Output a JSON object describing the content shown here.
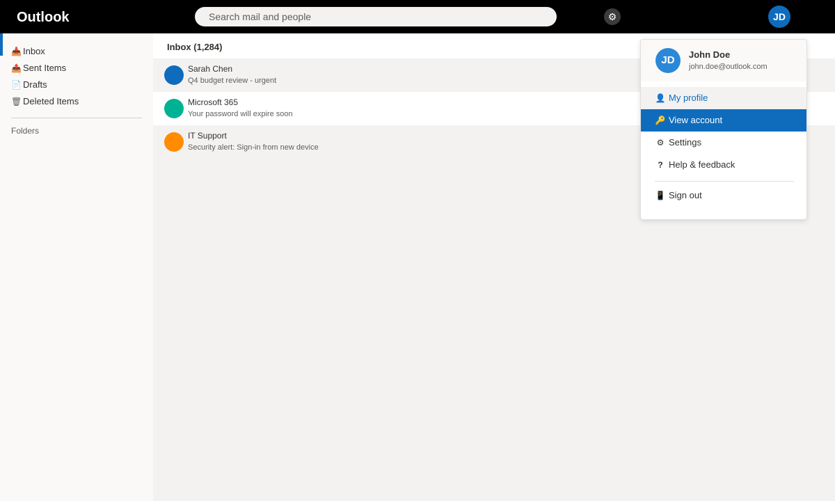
{
  "app": {
    "brand": "Outlook"
  },
  "search": {
    "placeholder": "Search mail and people"
  },
  "topbar": {
    "settings_icon": "⚙",
    "avatar_initials": "JD"
  },
  "sidebar": {
    "items": [
      {
        "label": "Inbox",
        "icon": "📥"
      },
      {
        "label": "Sent Items",
        "icon": "📤"
      },
      {
        "label": "Drafts",
        "icon": "📄"
      },
      {
        "label": "Deleted Items",
        "icon": "🗑"
      }
    ],
    "folders_label": "Folders"
  },
  "mail_list": {
    "title": "Inbox (1,284)",
    "messages": [
      {
        "sender": "Sarah Chen",
        "subject": "Q4 budget review - urgent",
        "color": "#0f6cbd"
      },
      {
        "sender": "Microsoft 365",
        "subject": "Your password will expire soon",
        "color": "#00b294"
      },
      {
        "sender": "IT Support",
        "subject": "Security alert: Sign-in from new device",
        "color": "#ff8c00"
      }
    ]
  },
  "account_menu": {
    "initials": "JD",
    "name": "John Doe",
    "email": "john.doe@outlook.com",
    "items": [
      {
        "label": "My profile",
        "icon": "👤"
      },
      {
        "label": "View account",
        "icon": "🔑"
      },
      {
        "label": "Settings",
        "icon": "⚙"
      },
      {
        "label": "Help & feedback",
        "icon": "?"
      },
      {
        "label": "Sign out",
        "icon": "📱"
      }
    ]
  },
  "colors": {
    "accent": "#0f6cbd",
    "topbar": "#000000",
    "sidebar": "#faf9f8"
  }
}
